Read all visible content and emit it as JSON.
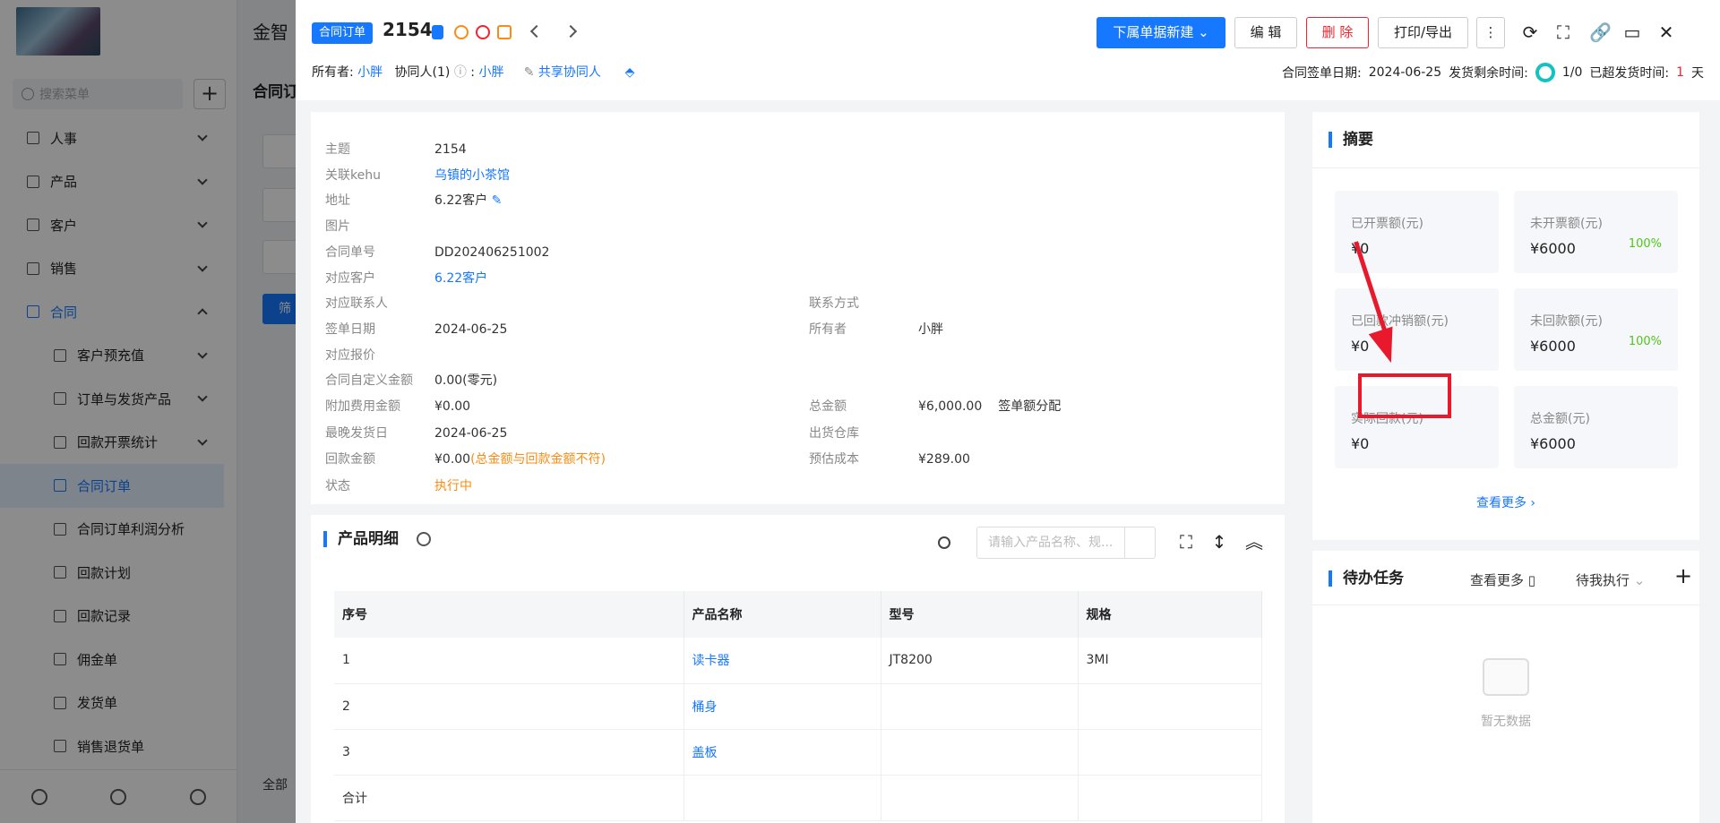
{
  "bg": {
    "app_name": "金智",
    "search_placeholder": "搜索菜单",
    "main_heading": "合同订",
    "menu": [
      {
        "label": "人事"
      },
      {
        "label": "产品"
      },
      {
        "label": "客户"
      },
      {
        "label": "销售"
      },
      {
        "label": "合同"
      },
      {
        "label": "客户预充值"
      },
      {
        "label": "订单与发货产品"
      },
      {
        "label": "回款开票统计"
      },
      {
        "label": "合同订单"
      },
      {
        "label": "合同订单利润分析"
      },
      {
        "label": "回款计划"
      },
      {
        "label": "回款记录"
      },
      {
        "label": "佣金单"
      },
      {
        "label": "发货单"
      },
      {
        "label": "销售退货单"
      }
    ],
    "filter_btn": "筛",
    "bottom_text": "全部"
  },
  "drawer": {
    "tag": "合同订单",
    "title": "2154",
    "buttons": {
      "new_sub": "下属单据新建",
      "edit": "编 辑",
      "delete": "删 除",
      "print": "打印/导出"
    },
    "owner_label": "所有者:",
    "owner": "小胖",
    "collab_label": "协同人(1)",
    "collab_sep": ":",
    "collab": "小胖",
    "share": "共享协同人",
    "sign_date_label": "合同签单日期:",
    "sign_date": "2024-06-25",
    "ship_remain_label": "发货剩余时间:",
    "ship_ratio": "1/0",
    "overdue_label": "已超发货时间:",
    "overdue_val": "1",
    "overdue_unit": "天"
  },
  "info": {
    "fields_left": [
      {
        "label": "主题",
        "value": "2154",
        "style": ""
      },
      {
        "label": "关联kehu",
        "value": "乌镇的小茶馆",
        "style": "link"
      },
      {
        "label": "地址",
        "value": "6.22客户",
        "style": ""
      },
      {
        "label": "图片",
        "value": "",
        "style": ""
      },
      {
        "label": "合同单号",
        "value": "DD202406251002",
        "style": ""
      },
      {
        "label": "对应客户",
        "value": "6.22客户",
        "style": "link"
      },
      {
        "label": "对应联系人",
        "value": "",
        "style": ""
      },
      {
        "label": "签单日期",
        "value": "2024-06-25",
        "style": ""
      },
      {
        "label": "对应报价",
        "value": "",
        "style": ""
      },
      {
        "label": "合同自定义金额",
        "value": "0.00(零元)",
        "style": ""
      },
      {
        "label": "附加费用金额",
        "value": "¥0.00",
        "style": ""
      },
      {
        "label": "最晚发货日",
        "value": "2024-06-25",
        "style": ""
      },
      {
        "label": "回款金额",
        "value": "¥0.00",
        "style": ""
      },
      {
        "label": "状态",
        "value": "执行中",
        "style": "orange"
      }
    ],
    "payment_note": "(总金额与回款金额不符)",
    "fields_right": [
      {
        "label": "联系方式",
        "value": ""
      },
      {
        "label": "所有者",
        "value": "小胖"
      },
      {
        "label": "总金额",
        "value": "¥6,000.00"
      },
      {
        "label": "出货仓库",
        "value": ""
      },
      {
        "label": "预估成本",
        "value": "¥289.00"
      }
    ],
    "sign_split_label": "签单额分配"
  },
  "products": {
    "title": "产品明细",
    "search_placeholder": "请输入产品名称、规...",
    "columns": [
      "序号",
      "产品名称",
      "型号",
      "规格"
    ],
    "rows": [
      [
        "1",
        "读卡器",
        "JT8200",
        "3MI"
      ],
      [
        "2",
        "桶身",
        "",
        ""
      ],
      [
        "3",
        "盖板",
        "",
        ""
      ],
      [
        "合计",
        "",
        "",
        ""
      ]
    ]
  },
  "summary": {
    "title": "摘要",
    "boxes": [
      {
        "label": "已开票额(元)",
        "value": "¥0",
        "pct": ""
      },
      {
        "label": "未开票额(元)",
        "value": "¥6000",
        "pct": "100%"
      },
      {
        "label": "已回款冲销额(元)",
        "value": "¥0",
        "pct": ""
      },
      {
        "label": "未回款额(元)",
        "value": "¥6000",
        "pct": "100%"
      },
      {
        "label": "实际回款(元)",
        "value": "¥0",
        "pct": ""
      },
      {
        "label": "总金额(元)",
        "value": "¥6000",
        "pct": ""
      }
    ],
    "more": "查看更多"
  },
  "todo": {
    "title": "待办任务",
    "more": "查看更多",
    "filter": "待我执行",
    "empty": "暂无数据"
  }
}
